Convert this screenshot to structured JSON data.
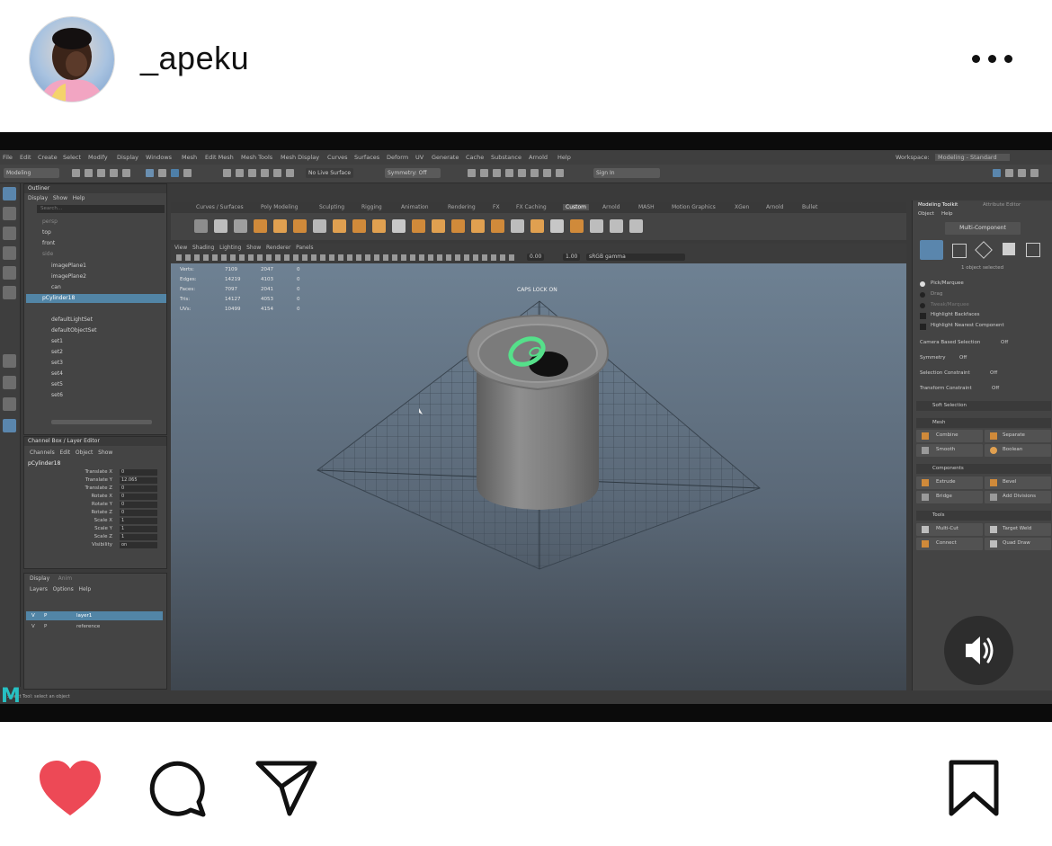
{
  "post": {
    "username": "_apeku"
  },
  "media": {
    "app_menu": [
      "File",
      "Edit",
      "Create",
      "Select",
      "Modify",
      "Display",
      "Windows",
      "Mesh",
      "Edit Mesh",
      "Mesh Tools",
      "Mesh Display",
      "Curves",
      "Surfaces",
      "Deform",
      "UV",
      "Generate",
      "Cache",
      "Substance",
      "Arnold",
      "Help"
    ],
    "workspace_label": "Workspace:",
    "workspace_value": "Modeling - Standard",
    "mode_select": "Modeling",
    "live_surface": "No Live Surface",
    "symmetry": "Symmetry: Off",
    "sign_in": "Sign In",
    "shelf_tabs": [
      "Curves / Surfaces",
      "Poly Modeling",
      "Sculpting",
      "Rigging",
      "Animation",
      "Rendering",
      "FX",
      "FX Caching",
      "Custom",
      "Arnold",
      "MASH",
      "Motion Graphics",
      "XGen",
      "Arnold",
      "Bullet"
    ],
    "outliner": {
      "title": "Outliner",
      "menu": [
        "Display",
        "Show",
        "Help"
      ],
      "search_placeholder": "Search...",
      "items": [
        "persp",
        "top",
        "front",
        "side",
        "imagePlane1",
        "imagePlane2",
        "can",
        "pCylinder18",
        "defaultLightSet",
        "defaultObjectSet",
        "set1",
        "set2",
        "set3",
        "set4",
        "set5",
        "set6"
      ],
      "selected_index": 7
    },
    "channel_box": {
      "title": "Channel Box / Layer Editor",
      "menu": [
        "Channels",
        "Edit",
        "Object",
        "Show"
      ],
      "object": "pCylinder18",
      "attributes": [
        {
          "name": "Translate X",
          "value": "0"
        },
        {
          "name": "Translate Y",
          "value": "12.065"
        },
        {
          "name": "Translate Z",
          "value": "0"
        },
        {
          "name": "Rotate X",
          "value": "0"
        },
        {
          "name": "Rotate Y",
          "value": "0"
        },
        {
          "name": "Rotate Z",
          "value": "0"
        },
        {
          "name": "Scale X",
          "value": "1"
        },
        {
          "name": "Scale Y",
          "value": "1"
        },
        {
          "name": "Scale Z",
          "value": "1"
        },
        {
          "name": "Visibility",
          "value": "on"
        }
      ]
    },
    "layers": {
      "tabs": [
        "Display",
        "Anim"
      ],
      "menu": [
        "Layers",
        "Options",
        "Help"
      ],
      "items": [
        {
          "v": "V",
          "p": "P",
          "name": "layer1"
        },
        {
          "v": "V",
          "p": "P",
          "name": "reference"
        }
      ]
    },
    "viewport": {
      "menu": [
        "View",
        "Shading",
        "Lighting",
        "Show",
        "Renderer",
        "Panels"
      ],
      "field1": "0.00",
      "field2": "1.00",
      "color_space": "sRGB gamma",
      "stats": [
        {
          "label": "Verts:",
          "a": "7109",
          "b": "2047",
          "c": "0"
        },
        {
          "label": "Edges:",
          "a": "14219",
          "b": "4103",
          "c": "0"
        },
        {
          "label": "Faces:",
          "a": "7097",
          "b": "2041",
          "c": "0"
        },
        {
          "label": "Tris:",
          "a": "14127",
          "b": "4053",
          "c": "0"
        },
        {
          "label": "UVs:",
          "a": "10499",
          "b": "4154",
          "c": "0"
        }
      ],
      "caps_lock": "CAPS LOCK ON",
      "camera": "persp"
    },
    "modeling_toolkit": {
      "tabs": [
        "Modeling Toolkit",
        "Attribute Editor"
      ],
      "menu": [
        "Object",
        "Help"
      ],
      "mode_button": "Multi-Component",
      "objects_selected": "1 object selected",
      "pick_options": [
        "Pick/Marquee",
        "Drag",
        "Tweak/Marquee"
      ],
      "checks": [
        "Highlight Backfaces",
        "Highlight Nearest Component"
      ],
      "settings": [
        {
          "label": "Camera Based Selection",
          "value": "Off"
        },
        {
          "label": "Symmetry",
          "value": "Off"
        },
        {
          "label": "Selection Constraint",
          "value": "Off"
        },
        {
          "label": "Transform Constraint",
          "value": "Off"
        }
      ],
      "soft_selection": "Soft Selection",
      "sections": {
        "mesh": "Mesh",
        "components": "Components",
        "tools": "Tools"
      },
      "mesh_buttons": [
        "Combine",
        "Separate",
        "Smooth",
        "Boolean"
      ],
      "component_buttons": [
        "Extrude",
        "Bevel",
        "Bridge",
        "Add Divisions"
      ],
      "tool_buttons": [
        "Multi-Cut",
        "Target Weld",
        "Connect",
        "Quad Draw"
      ]
    },
    "status_help": "Select Tool: select an object",
    "logo_letter": "M"
  },
  "actions": {
    "liked": true,
    "like_color": "#ed4956"
  },
  "icons": [
    "avatar",
    "more-icon",
    "sound-on-icon",
    "heart-icon",
    "comment-icon",
    "share-icon",
    "bookmark-icon"
  ]
}
